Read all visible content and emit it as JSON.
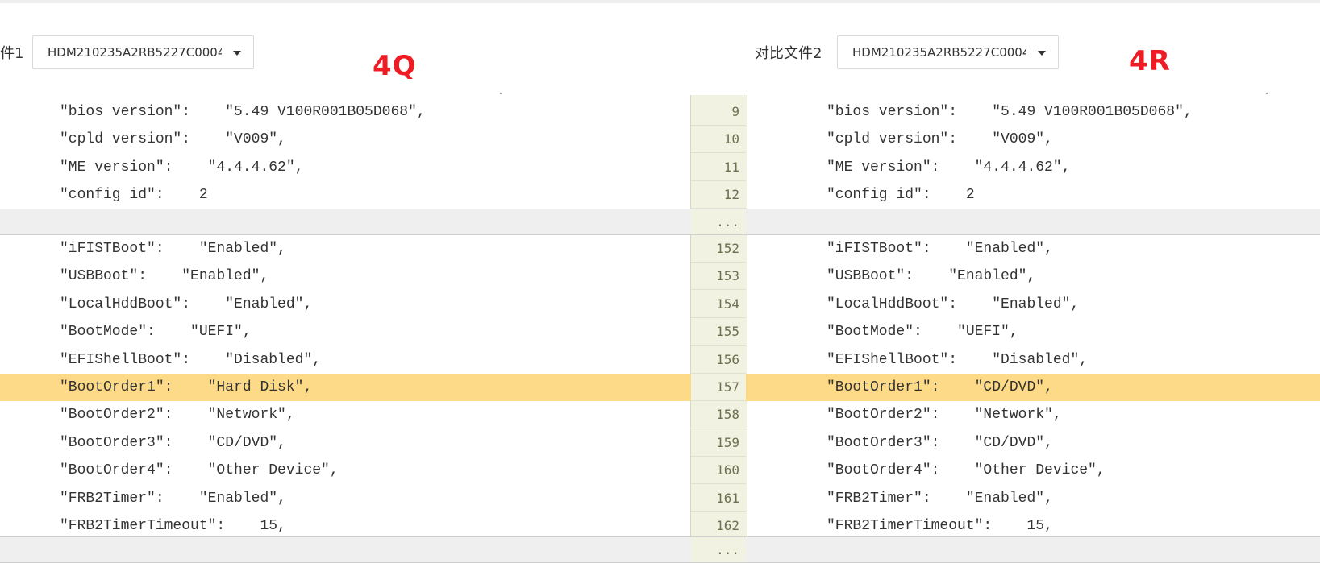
{
  "header": {
    "left_label": "件1",
    "left_select_value": "HDM210235A2RB5227C0004",
    "right_label": "对比文件2",
    "right_select_value": "HDM210235A2RB5227C0004"
  },
  "annotations": {
    "left": "4Q",
    "right": "4R"
  },
  "block1": [
    {
      "num": "9",
      "left": "\"bios version\":    \"5.49 V100R001B05D068\",",
      "right": "\"bios version\":    \"5.49 V100R001B05D068\","
    },
    {
      "num": "10",
      "left": "\"cpld version\":    \"V009\",",
      "right": "\"cpld version\":    \"V009\","
    },
    {
      "num": "11",
      "left": "\"ME version\":    \"4.4.4.62\",",
      "right": "\"ME version\":    \"4.4.4.62\","
    },
    {
      "num": "12",
      "left": "\"config id\":    2",
      "right": "\"config id\":    2"
    }
  ],
  "collapse1": "...",
  "block2": [
    {
      "num": "152",
      "left": "\"iFISTBoot\":    \"Enabled\",",
      "right": "\"iFISTBoot\":    \"Enabled\","
    },
    {
      "num": "153",
      "left": "\"USBBoot\":    \"Enabled\",",
      "right": "\"USBBoot\":    \"Enabled\","
    },
    {
      "num": "154",
      "left": "\"LocalHddBoot\":    \"Enabled\",",
      "right": "\"LocalHddBoot\":    \"Enabled\","
    },
    {
      "num": "155",
      "left": "\"BootMode\":    \"UEFI\",",
      "right": "\"BootMode\":    \"UEFI\","
    },
    {
      "num": "156",
      "left": "\"EFIShellBoot\":    \"Disabled\",",
      "right": "\"EFIShellBoot\":    \"Disabled\","
    },
    {
      "num": "157",
      "left": "\"BootOrder1\":    \"Hard Disk\",",
      "right": "\"BootOrder1\":    \"CD/DVD\",",
      "changed": true
    },
    {
      "num": "158",
      "left": "\"BootOrder2\":    \"Network\",",
      "right": "\"BootOrder2\":    \"Network\","
    },
    {
      "num": "159",
      "left": "\"BootOrder3\":    \"CD/DVD\",",
      "right": "\"BootOrder3\":    \"CD/DVD\","
    },
    {
      "num": "160",
      "left": "\"BootOrder4\":    \"Other Device\",",
      "right": "\"BootOrder4\":    \"Other Device\","
    },
    {
      "num": "161",
      "left": "\"FRB2Timer\":    \"Enabled\",",
      "right": "\"FRB2Timer\":    \"Enabled\","
    },
    {
      "num": "162",
      "left": "\"FRB2TimerTimeout\":    15,",
      "right": "\"FRB2TimerTimeout\":    15,"
    }
  ],
  "collapse2": "...",
  "colors": {
    "changed_row": "#fdda88",
    "gutter": "#f1f2e1",
    "annotation": "#ee1c25"
  }
}
